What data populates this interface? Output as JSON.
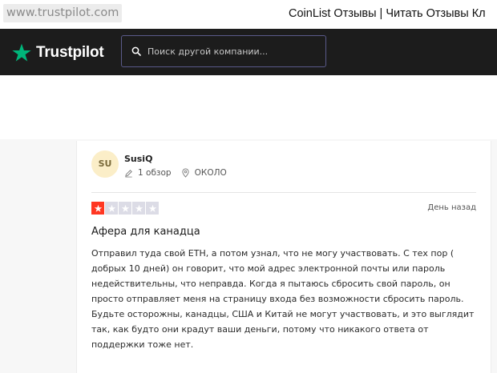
{
  "browser": {
    "url": "www.trustpilot.com",
    "page_title": "CoinList Отзывы | Читать Отзывы Кл"
  },
  "header": {
    "logo_text": "Trustpilot",
    "search_placeholder": "Поиск другой компании..."
  },
  "colors": {
    "header_bg": "#1c1c1c",
    "logo_star": "#00b67a",
    "one_star_red": "#ff3722",
    "empty_star": "#dcdce6"
  },
  "review": {
    "avatar_initials": "SU",
    "user_name": "SusiQ",
    "reviews_count": "1 обзор",
    "location": "ОКОЛО",
    "rating": 1,
    "rating_max": 5,
    "date": "День назад",
    "title": "Афера для канадца",
    "body": "Отправил туда свой ETH, а потом узнал, что не могу участвовать. С тех пор ( добрых 10 дней) он говорит, что мой адрес электронной почты или пароль недействительны, что неправда. Когда я пытаюсь сбросить свой пароль, он просто отправляет меня на страницу входа без возможности сбросить пароль. Будьте осторожны, канадцы, США и Китай не могут участвовать, и это выглядит так, как будто они крадут ваши деньги, потому что никакого ответа от поддержки тоже нет."
  }
}
